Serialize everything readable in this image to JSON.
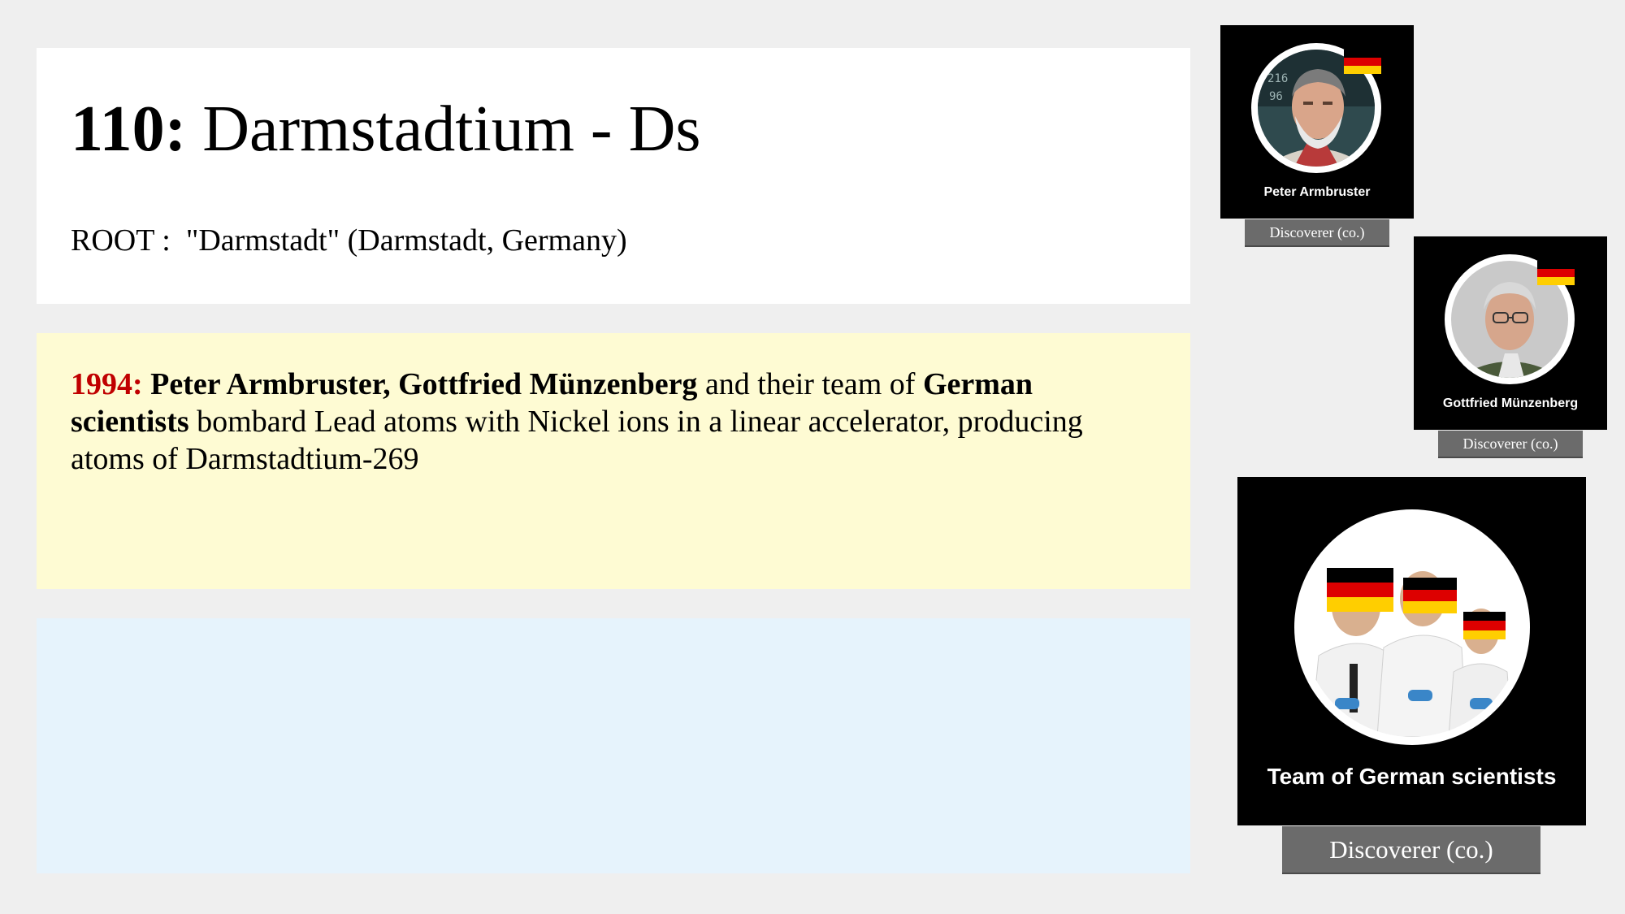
{
  "element": {
    "number_label": "110:",
    "name_symbol": "Darmstadtium - Ds",
    "root_text": "ROOT :  \"Darmstadt\" (Darmstadt, Germany)"
  },
  "discovery": {
    "year": "1994:",
    "discoverers_bold": "Peter Armbruster, Gottfried Münzenberg",
    "text_1": " and their team of ",
    "team_bold": "German scientists",
    "text_2": " bombard Lead atoms with Nickel ions in a linear accelerator, producing atoms of Darmstadtium-269"
  },
  "cards": [
    {
      "name": "Peter Armbruster",
      "badge": "Discoverer (co.)",
      "flag_icon": "germany-flag-icon"
    },
    {
      "name": "Gottfried Münzenberg",
      "badge": "Discoverer (co.)",
      "flag_icon": "germany-flag-icon"
    },
    {
      "name": "Team of German scientists",
      "badge": "Discoverer (co.)",
      "flag_icon": "germany-flag-icon"
    }
  ],
  "colors": {
    "background": "#efefef",
    "title_panel": "#ffffff",
    "event_panel": "#fefbd3",
    "blank_panel": "#e6f3fc",
    "year_accent": "#c00000",
    "badge": "#6b6b6b",
    "flag": [
      "#000000",
      "#dd0000",
      "#ffce00"
    ]
  }
}
